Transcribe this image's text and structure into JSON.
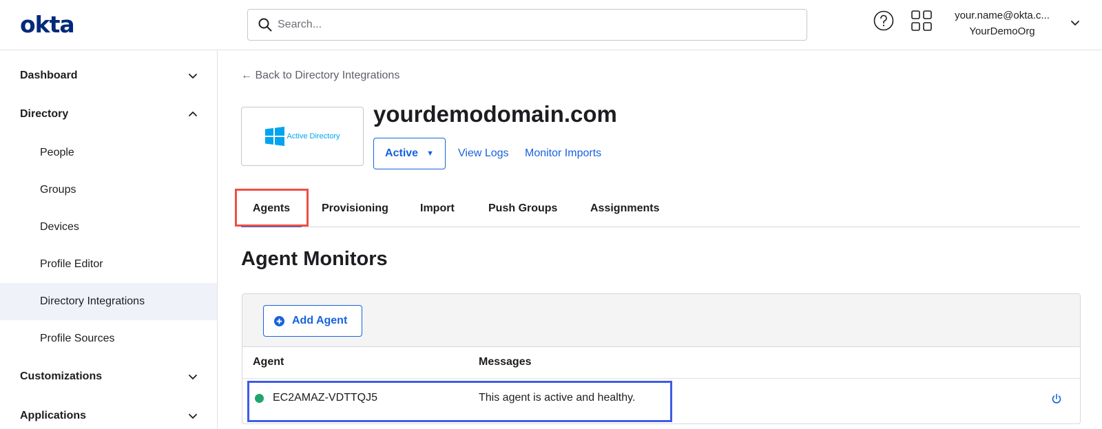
{
  "header": {
    "logo": "okta",
    "search_placeholder": "Search...",
    "user_email": "your.name@okta.c...",
    "user_org": "YourDemoOrg"
  },
  "sidebar": {
    "sections": [
      {
        "label": "Dashboard",
        "expanded": false
      },
      {
        "label": "Directory",
        "expanded": true
      },
      {
        "label": "Customizations",
        "expanded": false
      },
      {
        "label": "Applications",
        "expanded": false
      }
    ],
    "directory_items": [
      {
        "label": "People"
      },
      {
        "label": "Groups"
      },
      {
        "label": "Devices"
      },
      {
        "label": "Profile Editor"
      },
      {
        "label": "Directory Integrations",
        "active": true
      },
      {
        "label": "Profile Sources"
      }
    ]
  },
  "main": {
    "back_link": "← Back to Directory Integrations",
    "app_logo_text": "Active Directory",
    "title": "yourdemodomain.com",
    "status_button": "Active",
    "status_caret": "▼",
    "links": {
      "view_logs": "View Logs",
      "monitor_imports": "Monitor Imports"
    },
    "tabs": [
      {
        "label": "Agents",
        "active": true
      },
      {
        "label": "Provisioning"
      },
      {
        "label": "Import"
      },
      {
        "label": "Push Groups"
      },
      {
        "label": "Assignments"
      }
    ],
    "section_title": "Agent Monitors",
    "add_agent_label": "Add Agent",
    "table": {
      "columns": [
        "Agent",
        "Messages"
      ],
      "rows": [
        {
          "agent": "EC2AMAZ-VDTTQJ5",
          "message": "This agent is active and healthy.",
          "status": "healthy"
        }
      ]
    }
  },
  "colors": {
    "brand": "#00297a",
    "accent": "#1662dd",
    "healthy": "#20a56b",
    "tab_highlight": "#ef4e43",
    "row_highlight": "#3d5ce8",
    "windows_blue": "#00a4ef"
  },
  "icons": {
    "search": "search-icon",
    "help": "help-icon",
    "apps": "apps-grid-icon",
    "chevron": "chevron-down-icon",
    "windows": "windows-logo-icon",
    "add": "plus-circle-icon",
    "power": "power-icon"
  }
}
